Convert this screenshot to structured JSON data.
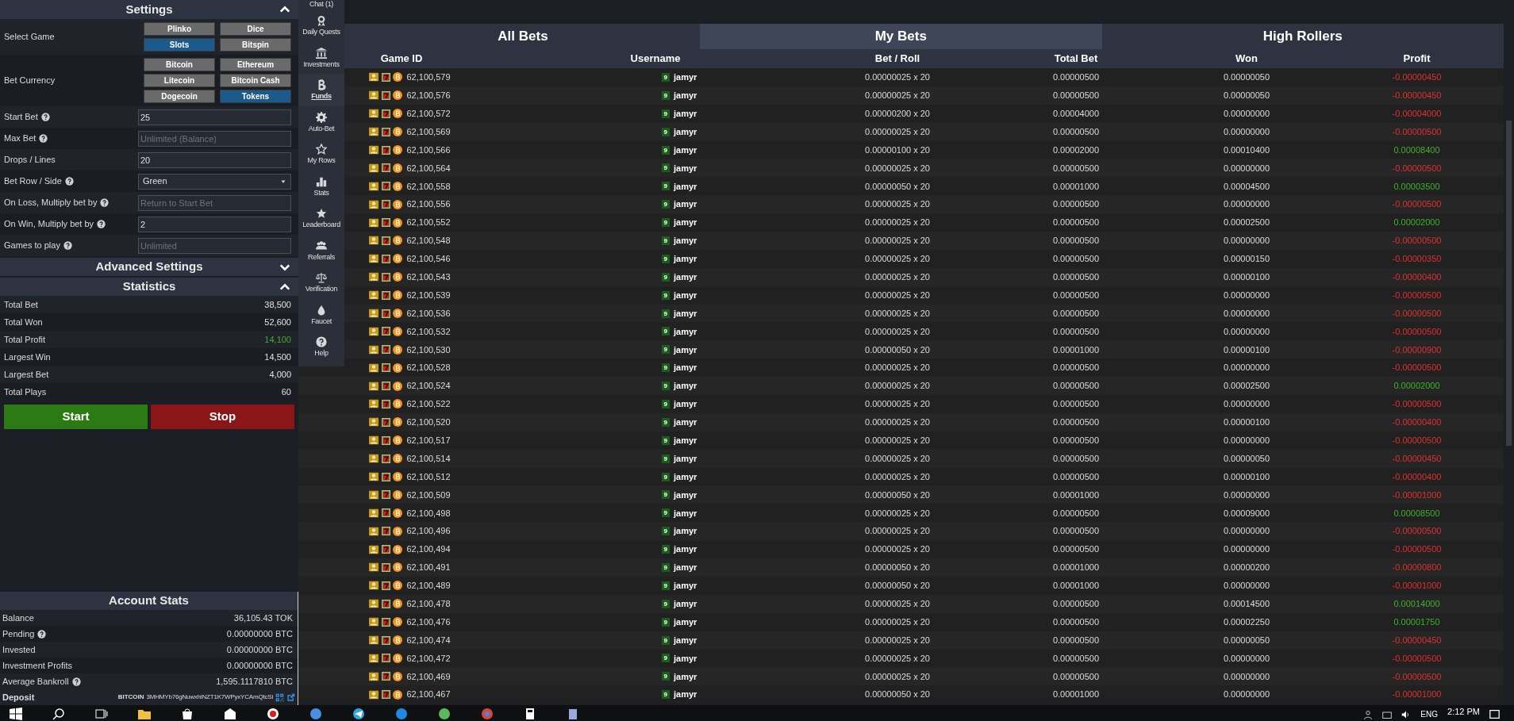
{
  "settings": {
    "title": "Settings",
    "expanded": true,
    "select_game": {
      "label": "Select Game",
      "options": [
        {
          "label": "Plinko",
          "selected": false
        },
        {
          "label": "Dice",
          "selected": false
        },
        {
          "label": "Slots",
          "selected": true
        },
        {
          "label": "Bitspin",
          "selected": false
        }
      ]
    },
    "bet_currency": {
      "label": "Bet Currency",
      "options": [
        {
          "label": "Bitcoin",
          "selected": false
        },
        {
          "label": "Ethereum",
          "selected": false
        },
        {
          "label": "Litecoin",
          "selected": false
        },
        {
          "label": "Bitcoin Cash",
          "selected": false
        },
        {
          "label": "Dogecoin",
          "selected": false
        },
        {
          "label": "Tokens",
          "selected": true
        }
      ]
    },
    "fields": [
      {
        "label": "Start Bet",
        "help": true,
        "kind": "input",
        "value": "25"
      },
      {
        "label": "Max Bet",
        "help": true,
        "kind": "input",
        "placeholder": "Unlimited (Balance)"
      },
      {
        "label": "Drops / Lines",
        "help": false,
        "kind": "input",
        "value": "20"
      },
      {
        "label": "Bet Row / Side",
        "help": true,
        "kind": "select",
        "value": "Green"
      },
      {
        "label": "On Loss, Multiply bet by",
        "help": true,
        "kind": "input",
        "placeholder": "Return to Start Bet"
      },
      {
        "label": "On Win, Multiply bet by",
        "help": true,
        "kind": "input",
        "value": "2"
      },
      {
        "label": "Games to play",
        "help": true,
        "kind": "input",
        "placeholder": "Unlimited"
      }
    ]
  },
  "advanced_settings": {
    "title": "Advanced Settings",
    "expanded": false
  },
  "statistics": {
    "title": "Statistics",
    "expanded": true,
    "rows": [
      {
        "label": "Total Bet",
        "value": "38,500",
        "positive": false
      },
      {
        "label": "Total Won",
        "value": "52,600",
        "positive": false
      },
      {
        "label": "Total Profit",
        "value": "14,100",
        "positive": true
      },
      {
        "label": "Largest Win",
        "value": "14,500",
        "positive": false
      },
      {
        "label": "Largest Bet",
        "value": "4,000",
        "positive": false
      },
      {
        "label": "Total Plays",
        "value": "60",
        "positive": false
      }
    ]
  },
  "buttons": [
    {
      "label": "Start",
      "kind": "start"
    },
    {
      "label": "Stop",
      "kind": "stop"
    }
  ],
  "account_stats": {
    "title": "Account Stats",
    "rows": [
      {
        "label": "Balance",
        "help": false,
        "value": "36,105.43 TOK"
      },
      {
        "label": "Pending",
        "help": true,
        "value": "0.00000000 BTC"
      },
      {
        "label": "Invested",
        "help": false,
        "value": "0.00000000 BTC"
      },
      {
        "label": "Investment Profits",
        "help": false,
        "value": "0.00000000 BTC"
      },
      {
        "label": "Average Bankroll",
        "help": true,
        "value": "1,595.1117810 BTC"
      }
    ],
    "deposit": {
      "label": "Deposit",
      "currency": "BITCOIN",
      "address": "3MHMYb76gNuwxhiNZT1K7WPyxYCAmQtcSi"
    }
  },
  "nav": [
    {
      "label": "Chat (1)",
      "selected": false
    },
    {
      "label": "Daily Quests",
      "selected": false
    },
    {
      "label": "Investments",
      "selected": false
    },
    {
      "label": "Funds",
      "selected": true
    },
    {
      "label": "Auto-Bet",
      "selected": false
    },
    {
      "label": "My Rows",
      "selected": false
    },
    {
      "label": "Stats",
      "selected": false
    },
    {
      "label": "Leaderboard",
      "selected": false
    },
    {
      "label": "Referrals",
      "selected": false
    },
    {
      "label": "Verification",
      "selected": false
    },
    {
      "label": "Faucet",
      "selected": false
    },
    {
      "label": "Help",
      "selected": false
    }
  ],
  "bets": {
    "tabs": [
      {
        "label": "All Bets",
        "selected": false
      },
      {
        "label": "My Bets",
        "selected": true
      },
      {
        "label": "High Rollers",
        "selected": false
      }
    ],
    "columns": [
      "Game ID",
      "Username",
      "Bet / Roll",
      "Total Bet",
      "Won",
      "Profit"
    ],
    "rows": [
      {
        "game_id": "62,100,579",
        "badge": "9",
        "username": "jamyr",
        "bet_roll": "0.00000025 x 20",
        "total_bet": "0.00000500",
        "won": "0.00000050",
        "profit": "-0.00000450",
        "kind": "loss"
      },
      {
        "game_id": "62,100,576",
        "badge": "9",
        "username": "jamyr",
        "bet_roll": "0.00000025 x 20",
        "total_bet": "0.00000500",
        "won": "0.00000050",
        "profit": "-0.00000450",
        "kind": "loss"
      },
      {
        "game_id": "62,100,572",
        "badge": "9",
        "username": "jamyr",
        "bet_roll": "0.00000200 x 20",
        "total_bet": "0.00004000",
        "won": "0.00000000",
        "profit": "-0.00004000",
        "kind": "loss"
      },
      {
        "game_id": "62,100,569",
        "badge": "9",
        "username": "jamyr",
        "bet_roll": "0.00000025 x 20",
        "total_bet": "0.00000500",
        "won": "0.00000000",
        "profit": "-0.00000500",
        "kind": "loss"
      },
      {
        "game_id": "62,100,566",
        "badge": "9",
        "username": "jamyr",
        "bet_roll": "0.00000100 x 20",
        "total_bet": "0.00002000",
        "won": "0.00010400",
        "profit": "0.00008400",
        "kind": "win"
      },
      {
        "game_id": "62,100,564",
        "badge": "9",
        "username": "jamyr",
        "bet_roll": "0.00000025 x 20",
        "total_bet": "0.00000500",
        "won": "0.00000000",
        "profit": "-0.00000500",
        "kind": "loss"
      },
      {
        "game_id": "62,100,558",
        "badge": "9",
        "username": "jamyr",
        "bet_roll": "0.00000050 x 20",
        "total_bet": "0.00001000",
        "won": "0.00004500",
        "profit": "0.00003500",
        "kind": "win"
      },
      {
        "game_id": "62,100,556",
        "badge": "9",
        "username": "jamyr",
        "bet_roll": "0.00000025 x 20",
        "total_bet": "0.00000500",
        "won": "0.00000000",
        "profit": "-0.00000500",
        "kind": "loss"
      },
      {
        "game_id": "62,100,552",
        "badge": "9",
        "username": "jamyr",
        "bet_roll": "0.00000025 x 20",
        "total_bet": "0.00000500",
        "won": "0.00002500",
        "profit": "0.00002000",
        "kind": "win"
      },
      {
        "game_id": "62,100,548",
        "badge": "9",
        "username": "jamyr",
        "bet_roll": "0.00000025 x 20",
        "total_bet": "0.00000500",
        "won": "0.00000000",
        "profit": "-0.00000500",
        "kind": "loss"
      },
      {
        "game_id": "62,100,546",
        "badge": "9",
        "username": "jamyr",
        "bet_roll": "0.00000025 x 20",
        "total_bet": "0.00000500",
        "won": "0.00000150",
        "profit": "-0.00000350",
        "kind": "loss"
      },
      {
        "game_id": "62,100,543",
        "badge": "9",
        "username": "jamyr",
        "bet_roll": "0.00000025 x 20",
        "total_bet": "0.00000500",
        "won": "0.00000100",
        "profit": "-0.00000400",
        "kind": "loss"
      },
      {
        "game_id": "62,100,539",
        "badge": "9",
        "username": "jamyr",
        "bet_roll": "0.00000025 x 20",
        "total_bet": "0.00000500",
        "won": "0.00000000",
        "profit": "-0.00000500",
        "kind": "loss"
      },
      {
        "game_id": "62,100,536",
        "badge": "9",
        "username": "jamyr",
        "bet_roll": "0.00000025 x 20",
        "total_bet": "0.00000500",
        "won": "0.00000000",
        "profit": "-0.00000500",
        "kind": "loss"
      },
      {
        "game_id": "62,100,532",
        "badge": "9",
        "username": "jamyr",
        "bet_roll": "0.00000025 x 20",
        "total_bet": "0.00000500",
        "won": "0.00000000",
        "profit": "-0.00000500",
        "kind": "loss"
      },
      {
        "game_id": "62,100,530",
        "badge": "9",
        "username": "jamyr",
        "bet_roll": "0.00000050 x 20",
        "total_bet": "0.00001000",
        "won": "0.00000100",
        "profit": "-0.00000900",
        "kind": "loss"
      },
      {
        "game_id": "62,100,528",
        "badge": "9",
        "username": "jamyr",
        "bet_roll": "0.00000025 x 20",
        "total_bet": "0.00000500",
        "won": "0.00000000",
        "profit": "-0.00000500",
        "kind": "loss"
      },
      {
        "game_id": "62,100,524",
        "badge": "9",
        "username": "jamyr",
        "bet_roll": "0.00000025 x 20",
        "total_bet": "0.00000500",
        "won": "0.00002500",
        "profit": "0.00002000",
        "kind": "win"
      },
      {
        "game_id": "62,100,522",
        "badge": "9",
        "username": "jamyr",
        "bet_roll": "0.00000025 x 20",
        "total_bet": "0.00000500",
        "won": "0.00000000",
        "profit": "-0.00000500",
        "kind": "loss"
      },
      {
        "game_id": "62,100,520",
        "badge": "9",
        "username": "jamyr",
        "bet_roll": "0.00000025 x 20",
        "total_bet": "0.00000500",
        "won": "0.00000100",
        "profit": "-0.00000400",
        "kind": "loss"
      },
      {
        "game_id": "62,100,517",
        "badge": "9",
        "username": "jamyr",
        "bet_roll": "0.00000025 x 20",
        "total_bet": "0.00000500",
        "won": "0.00000000",
        "profit": "-0.00000500",
        "kind": "loss"
      },
      {
        "game_id": "62,100,514",
        "badge": "9",
        "username": "jamyr",
        "bet_roll": "0.00000025 x 20",
        "total_bet": "0.00000500",
        "won": "0.00000050",
        "profit": "-0.00000450",
        "kind": "loss"
      },
      {
        "game_id": "62,100,512",
        "badge": "9",
        "username": "jamyr",
        "bet_roll": "0.00000025 x 20",
        "total_bet": "0.00000500",
        "won": "0.00000100",
        "profit": "-0.00000400",
        "kind": "loss"
      },
      {
        "game_id": "62,100,509",
        "badge": "9",
        "username": "jamyr",
        "bet_roll": "0.00000050 x 20",
        "total_bet": "0.00001000",
        "won": "0.00000000",
        "profit": "-0.00001000",
        "kind": "loss"
      },
      {
        "game_id": "62,100,498",
        "badge": "9",
        "username": "jamyr",
        "bet_roll": "0.00000025 x 20",
        "total_bet": "0.00000500",
        "won": "0.00009000",
        "profit": "0.00008500",
        "kind": "win"
      },
      {
        "game_id": "62,100,496",
        "badge": "9",
        "username": "jamyr",
        "bet_roll": "0.00000025 x 20",
        "total_bet": "0.00000500",
        "won": "0.00000000",
        "profit": "-0.00000500",
        "kind": "loss"
      },
      {
        "game_id": "62,100,494",
        "badge": "9",
        "username": "jamyr",
        "bet_roll": "0.00000025 x 20",
        "total_bet": "0.00000500",
        "won": "0.00000000",
        "profit": "-0.00000500",
        "kind": "loss"
      },
      {
        "game_id": "62,100,491",
        "badge": "9",
        "username": "jamyr",
        "bet_roll": "0.00000050 x 20",
        "total_bet": "0.00001000",
        "won": "0.00000200",
        "profit": "-0.00000800",
        "kind": "loss"
      },
      {
        "game_id": "62,100,489",
        "badge": "9",
        "username": "jamyr",
        "bet_roll": "0.00000050 x 20",
        "total_bet": "0.00001000",
        "won": "0.00000000",
        "profit": "-0.00001000",
        "kind": "loss"
      },
      {
        "game_id": "62,100,478",
        "badge": "9",
        "username": "jamyr",
        "bet_roll": "0.00000025 x 20",
        "total_bet": "0.00000500",
        "won": "0.00014500",
        "profit": "0.00014000",
        "kind": "win"
      },
      {
        "game_id": "62,100,476",
        "badge": "9",
        "username": "jamyr",
        "bet_roll": "0.00000025 x 20",
        "total_bet": "0.00000500",
        "won": "0.00002250",
        "profit": "0.00001750",
        "kind": "win"
      },
      {
        "game_id": "62,100,474",
        "badge": "9",
        "username": "jamyr",
        "bet_roll": "0.00000025 x 20",
        "total_bet": "0.00000500",
        "won": "0.00000050",
        "profit": "-0.00000450",
        "kind": "loss"
      },
      {
        "game_id": "62,100,472",
        "badge": "9",
        "username": "jamyr",
        "bet_roll": "0.00000025 x 20",
        "total_bet": "0.00000500",
        "won": "0.00000000",
        "profit": "-0.00000500",
        "kind": "loss"
      },
      {
        "game_id": "62,100,469",
        "badge": "9",
        "username": "jamyr",
        "bet_roll": "0.00000025 x 20",
        "total_bet": "0.00000500",
        "won": "0.00000000",
        "profit": "-0.00000500",
        "kind": "loss"
      },
      {
        "game_id": "62,100,467",
        "badge": "9",
        "username": "jamyr",
        "bet_roll": "0.00000050 x 20",
        "total_bet": "0.00001000",
        "won": "0.00000000",
        "profit": "-0.00001000",
        "kind": "loss"
      }
    ]
  },
  "taskbar": {
    "language": "ENG",
    "time": "2:12 PM"
  }
}
